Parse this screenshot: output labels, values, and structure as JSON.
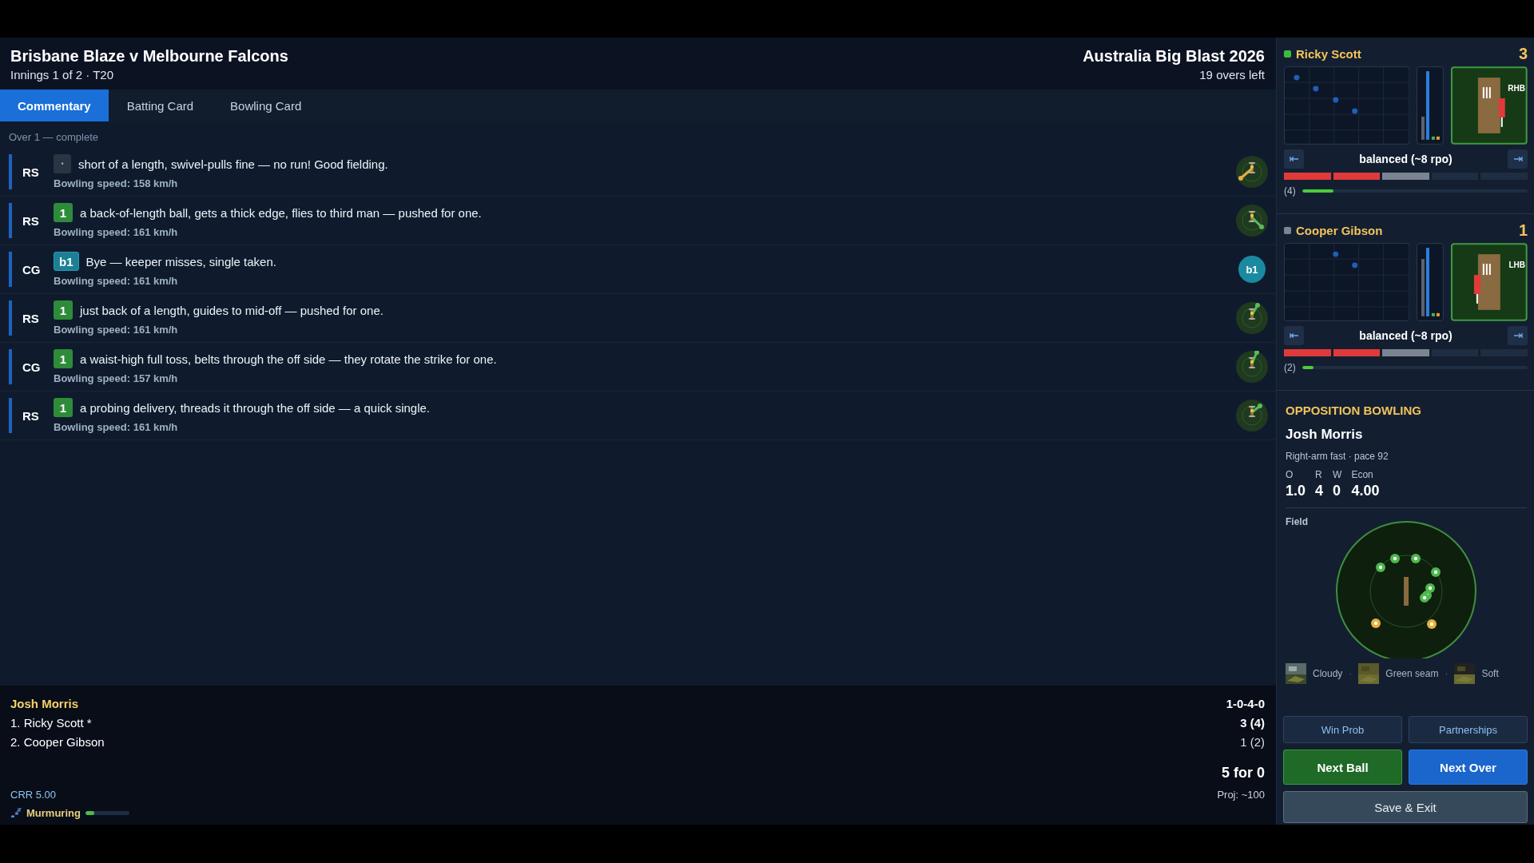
{
  "header": {
    "title": "Brisbane Blaze v Melbourne Falcons",
    "subtitle": "Innings 1 of 2 · T20",
    "competition": "Australia Big Blast 2026",
    "overs_left": "19 overs left"
  },
  "tabs": [
    {
      "label": "Commentary",
      "selected": true
    },
    {
      "label": "Batting Card",
      "selected": false
    },
    {
      "label": "Bowling Card",
      "selected": false
    }
  ],
  "over_label": "Over 1 — complete",
  "commentary": [
    {
      "batter": "RS",
      "badge": {
        "kind": "dot",
        "text": "•"
      },
      "text": "short of a length, swivel-pulls fine — no run! Good fielding.",
      "speed": "Bowling speed: 158 km/h",
      "outcome": {
        "kind": "wheel",
        "color": "#e0b040"
      }
    },
    {
      "batter": "RS",
      "badge": {
        "kind": "run",
        "text": "1"
      },
      "text": "a back-of-length ball, gets a thick edge, flies to third man — pushed for one.",
      "speed": "Bowling speed: 161 km/h",
      "outcome": {
        "kind": "wheel",
        "color": "#5cb85c"
      }
    },
    {
      "batter": "CG",
      "badge": {
        "kind": "bye",
        "text": "b1"
      },
      "text": "Bye — keeper misses, single taken.",
      "speed": "Bowling speed: 161 km/h",
      "outcome": {
        "kind": "marker",
        "text": "b1"
      }
    },
    {
      "batter": "RS",
      "badge": {
        "kind": "run",
        "text": "1"
      },
      "text": "just back of a length, guides to mid-off — pushed for one.",
      "speed": "Bowling speed: 161 km/h",
      "outcome": {
        "kind": "wheel",
        "color": "#5cb85c"
      }
    },
    {
      "batter": "CG",
      "badge": {
        "kind": "run",
        "text": "1"
      },
      "text": "a waist-high full toss, belts through the off side — they rotate the strike for one.",
      "speed": "Bowling speed: 157 km/h",
      "outcome": {
        "kind": "wheel",
        "color": "#5cb85c"
      }
    },
    {
      "batter": "RS",
      "badge": {
        "kind": "run",
        "text": "1"
      },
      "text": "a probing delivery, threads it through the off side — a quick single.",
      "speed": "Bowling speed: 161 km/h",
      "outcome": {
        "kind": "wheel",
        "color": "#5cb85c"
      }
    }
  ],
  "footer": {
    "bowler": "Josh Morris",
    "bowler_figures": "1-0-4-0",
    "batters": [
      {
        "line": "1. Ricky Scott *",
        "score": "3 (4)",
        "on_strike": true
      },
      {
        "line": "2. Cooper Gibson",
        "score": "1 (2)",
        "on_strike": false
      }
    ],
    "total": "5 for 0",
    "crr": "CRR 5.00",
    "projection": "Proj: ~100",
    "crowd": {
      "label": "Murmuring",
      "level": 0.2
    }
  },
  "batter_cards": [
    {
      "name": "Ricky Scott",
      "on_strike": true,
      "runs": "3",
      "hand": "RHB",
      "bat_left": false,
      "mode": "balanced (~8 rpo)",
      "segments": [
        {
          "kind": "hot"
        },
        {
          "kind": "hot"
        },
        {
          "kind": "neutral"
        },
        {
          "kind": "off"
        },
        {
          "kind": "off"
        }
      ],
      "balls": "(4)",
      "level": 0.14
    },
    {
      "name": "Cooper Gibson",
      "on_strike": false,
      "runs": "1",
      "hand": "LHB",
      "bat_left": true,
      "mode": "balanced (~8 rpo)",
      "segments": [
        {
          "kind": "hot"
        },
        {
          "kind": "hot"
        },
        {
          "kind": "neutral"
        },
        {
          "kind": "off"
        },
        {
          "kind": "off"
        }
      ],
      "balls": "(2)",
      "level": 0.05
    }
  ],
  "bowling": {
    "heading": "OPPOSITION BOWLING",
    "name": "Josh Morris",
    "description": "Right-arm fast · pace 92",
    "stats": [
      {
        "label": "O",
        "value": "1.0"
      },
      {
        "label": "R",
        "value": "4"
      },
      {
        "label": "W",
        "value": "0"
      },
      {
        "label": "Econ",
        "value": "4.00"
      }
    ],
    "field_label": "Field",
    "conditions": [
      {
        "label": "Cloudy"
      },
      {
        "label": "Green seam"
      },
      {
        "label": "Soft"
      }
    ],
    "separator": "·"
  },
  "buttons": [
    {
      "label": "Win Prob",
      "kind": "secondary"
    },
    {
      "label": "Partnerships",
      "kind": "secondary"
    },
    {
      "label": "Next Ball",
      "kind": "go"
    },
    {
      "label": "Next Over",
      "kind": "primary"
    },
    {
      "label": "Save & Exit",
      "kind": "wide"
    }
  ]
}
